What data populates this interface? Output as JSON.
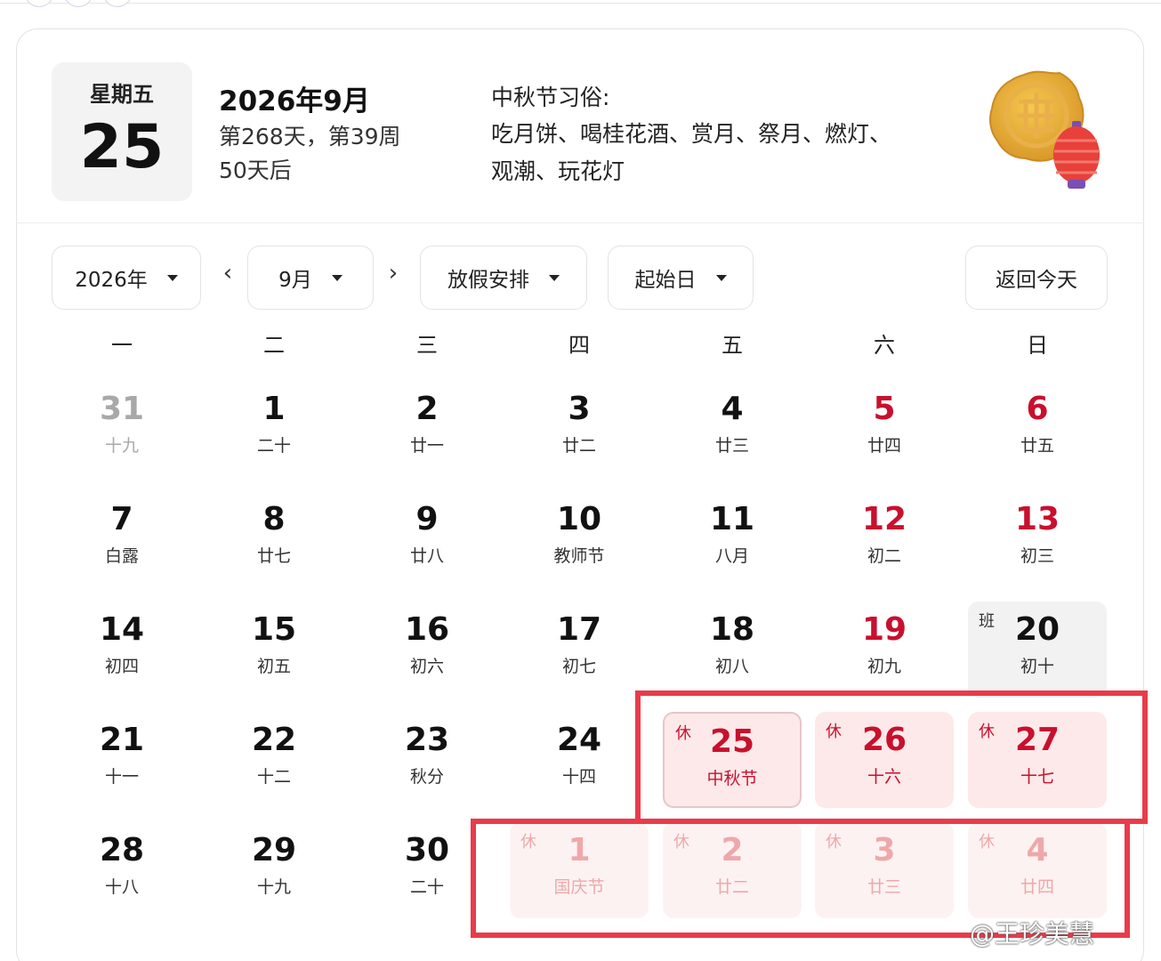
{
  "header": {
    "weekday": "星期五",
    "day": "25",
    "year_month": "2026年9月",
    "day_of_year": "第268天，第39周",
    "countdown": "50天后",
    "custom_title": "中秋节习俗:",
    "custom_text": "吃月饼、喝桂花酒、赏月、祭月、燃灯、观潮、玩花灯"
  },
  "controls": {
    "year": "2026年",
    "prev": "‹",
    "month": "9月",
    "next": "›",
    "holiday": "放假安排",
    "start_day": "起始日",
    "today": "返回今天"
  },
  "weekdays": [
    "一",
    "二",
    "三",
    "四",
    "五",
    "六",
    "日"
  ],
  "weeks": [
    [
      {
        "num": "31",
        "lunar": "十九",
        "style": "gray"
      },
      {
        "num": "1",
        "lunar": "二十"
      },
      {
        "num": "2",
        "lunar": "廿一"
      },
      {
        "num": "3",
        "lunar": "廿二"
      },
      {
        "num": "4",
        "lunar": "廿三"
      },
      {
        "num": "5",
        "lunar": "廿四",
        "style": "red"
      },
      {
        "num": "6",
        "lunar": "廿五",
        "style": "red"
      }
    ],
    [
      {
        "num": "7",
        "lunar": "白露"
      },
      {
        "num": "8",
        "lunar": "廿七"
      },
      {
        "num": "9",
        "lunar": "廿八"
      },
      {
        "num": "10",
        "lunar": "教师节"
      },
      {
        "num": "11",
        "lunar": "八月"
      },
      {
        "num": "12",
        "lunar": "初二",
        "style": "red"
      },
      {
        "num": "13",
        "lunar": "初三",
        "style": "red"
      }
    ],
    [
      {
        "num": "14",
        "lunar": "初四"
      },
      {
        "num": "15",
        "lunar": "初五"
      },
      {
        "num": "16",
        "lunar": "初六"
      },
      {
        "num": "17",
        "lunar": "初七"
      },
      {
        "num": "18",
        "lunar": "初八"
      },
      {
        "num": "19",
        "lunar": "初九",
        "style": "red"
      },
      {
        "num": "20",
        "lunar": "初十",
        "style": "work",
        "tag": "班"
      }
    ],
    [
      {
        "num": "21",
        "lunar": "十一"
      },
      {
        "num": "22",
        "lunar": "十二"
      },
      {
        "num": "23",
        "lunar": "秋分"
      },
      {
        "num": "24",
        "lunar": "十四"
      },
      {
        "num": "25",
        "lunar": "中秋节",
        "style": "holiday today",
        "tag": "休"
      },
      {
        "num": "26",
        "lunar": "十六",
        "style": "holiday",
        "tag": "休"
      },
      {
        "num": "27",
        "lunar": "十七",
        "style": "holiday",
        "tag": "休"
      }
    ],
    [
      {
        "num": "28",
        "lunar": "十八"
      },
      {
        "num": "29",
        "lunar": "十九"
      },
      {
        "num": "30",
        "lunar": "二十"
      },
      {
        "num": "1",
        "lunar": "国庆节",
        "style": "holiday fade",
        "tag": "休"
      },
      {
        "num": "2",
        "lunar": "廿二",
        "style": "holiday fade",
        "tag": "休"
      },
      {
        "num": "3",
        "lunar": "廿三",
        "style": "holiday fade",
        "tag": "休"
      },
      {
        "num": "4",
        "lunar": "廿四",
        "style": "holiday fade",
        "tag": "休"
      }
    ]
  ],
  "colors": {
    "holiday_red": "#c8102e",
    "holiday_bg": "#fde9e9",
    "highlight_border": "#e93b4a"
  },
  "icons": {
    "mooncake": "mooncake-lantern-icon"
  },
  "watermark": "@王珍美慧"
}
